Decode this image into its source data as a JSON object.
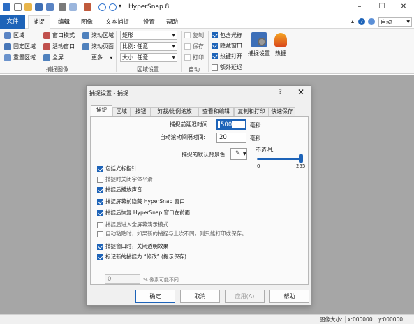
{
  "app": {
    "title": "HyperSnap 8",
    "window_controls": [
      "–",
      "☐",
      "✕"
    ]
  },
  "quick_access": [
    "new-icon",
    "open-icon",
    "save-icon",
    "capture-icon",
    "print-icon",
    "copy-icon",
    "settings-icon",
    "undo-icon",
    "redo-icon",
    "dropdown-icon"
  ],
  "ribbon_tabs": {
    "file": "文件",
    "items": [
      "捕捉",
      "编辑",
      "图像",
      "文本捕捉",
      "设置",
      "帮助"
    ]
  },
  "ribbon_right": {
    "mode": "自动"
  },
  "ribbon": {
    "capture_image": {
      "col1": [
        "区域",
        "固定区域",
        "重置区域"
      ],
      "col2": [
        "窗口模式",
        "活动窗口",
        "全屏"
      ],
      "col3": [
        "滚动区域",
        "滚动页面",
        "更多..."
      ],
      "label": "捕捉图像"
    },
    "region_settings": {
      "shape": "矩形",
      "ratio": "比例: 任意",
      "size": "大小: 任意",
      "label": "区域设置"
    },
    "auto": {
      "items": [
        "复制",
        "保存",
        "打印"
      ],
      "label": "自动"
    },
    "options": {
      "items": [
        "包含光标",
        "隐藏窗口",
        "热键打开",
        "额外延迟"
      ],
      "capture_settings": "捕捉设置",
      "hotkeys": "热键",
      "checked": [
        true,
        true,
        true,
        false
      ]
    }
  },
  "status_bar": {
    "image_size": "图像大小:",
    "x": "x:000000",
    "y": "y:000000"
  },
  "dialog": {
    "title": "捕捉设置 - 捕捉",
    "help": "?",
    "close": "✕",
    "tabs": [
      "捕捉",
      "区域",
      "按钮",
      "剪裁/比例缩放",
      "查看和编辑",
      "复制和打印",
      "快速保存"
    ],
    "active_tab": 0,
    "delay_label": "捕捉前延迟时间:",
    "delay_value": "500",
    "delay_unit": "毫秒",
    "scroll_label": "自动滚动间隔时间:",
    "scroll_value": "20",
    "scroll_unit": "毫秒",
    "bg_label": "捕捉的默认背景色",
    "opacity_label": "不透明:",
    "opacity_min": "0",
    "opacity_max": "255",
    "opacity_value": 255,
    "options": [
      {
        "label": "包括光标指针",
        "checked": true
      },
      {
        "label": "捕捉时关闭字体平滑",
        "checked": false
      },
      {
        "label": "捕捉后播放声音",
        "checked": true
      },
      {
        "label": "捕捉屏幕前隐藏 HyperSnap 窗口",
        "checked": true
      },
      {
        "label": "捕捉后恢复 HyperSnap 窗口在前面",
        "checked": true
      },
      {
        "label": "捕捉后进入全屏幕演示模式",
        "checked": false
      },
      {
        "label": "自动粘贴时，如果新的捕捉与上次不同，则只能打印或保存。",
        "checked": false
      },
      {
        "label": "捕捉窗口时，关闭透明效果",
        "checked": true
      },
      {
        "label": "标记新的捕捉为 “修改” (提示保存)",
        "checked": true
      }
    ],
    "diff_value": "0",
    "diff_label": "% 像素可能不同",
    "buttons": {
      "ok": "确定",
      "cancel": "取消",
      "apply": "应用(A)",
      "help": "帮助"
    }
  },
  "colors": {
    "accent": "#1d63b8",
    "workspace": "#a6a6a6"
  }
}
